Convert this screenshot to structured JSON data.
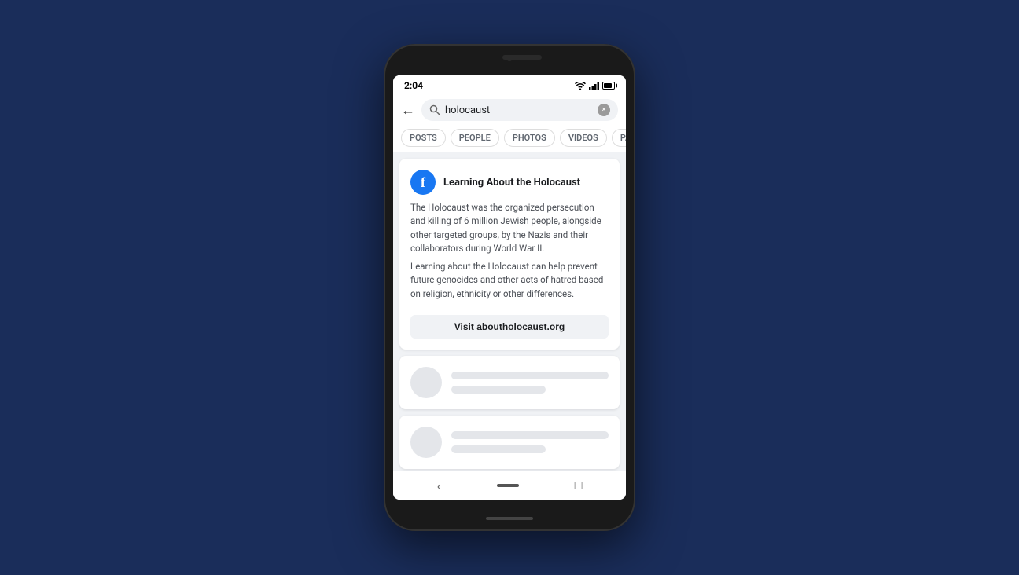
{
  "background_color": "#1a2d5a",
  "phone": {
    "status_bar": {
      "time": "2:04",
      "icons": [
        "wifi",
        "signal",
        "battery"
      ]
    },
    "search": {
      "back_label": "←",
      "placeholder": "holocaust",
      "query": "holocaust",
      "clear_label": "×"
    },
    "filter_tabs": [
      {
        "label": "POSTS",
        "active": false
      },
      {
        "label": "PEOPLE",
        "active": false
      },
      {
        "label": "PHOTOS",
        "active": false
      },
      {
        "label": "VIDEOS",
        "active": false
      },
      {
        "label": "PAGE",
        "active": false
      }
    ],
    "info_card": {
      "icon_letter": "f",
      "title": "Learning About the Holocaust",
      "paragraph1": "The Holocaust was the organized persecution and killing of 6 million Jewish people, alongside other targeted groups, by the Nazis and their collaborators during World War II.",
      "paragraph2": "Learning about the Holocaust can help prevent future genocides and other acts of hatred based on religion, ethnicity or other differences.",
      "button_label": "Visit aboutholocaust.org"
    },
    "bottom_nav": {
      "back_label": "‹",
      "phone_label": "□"
    }
  }
}
